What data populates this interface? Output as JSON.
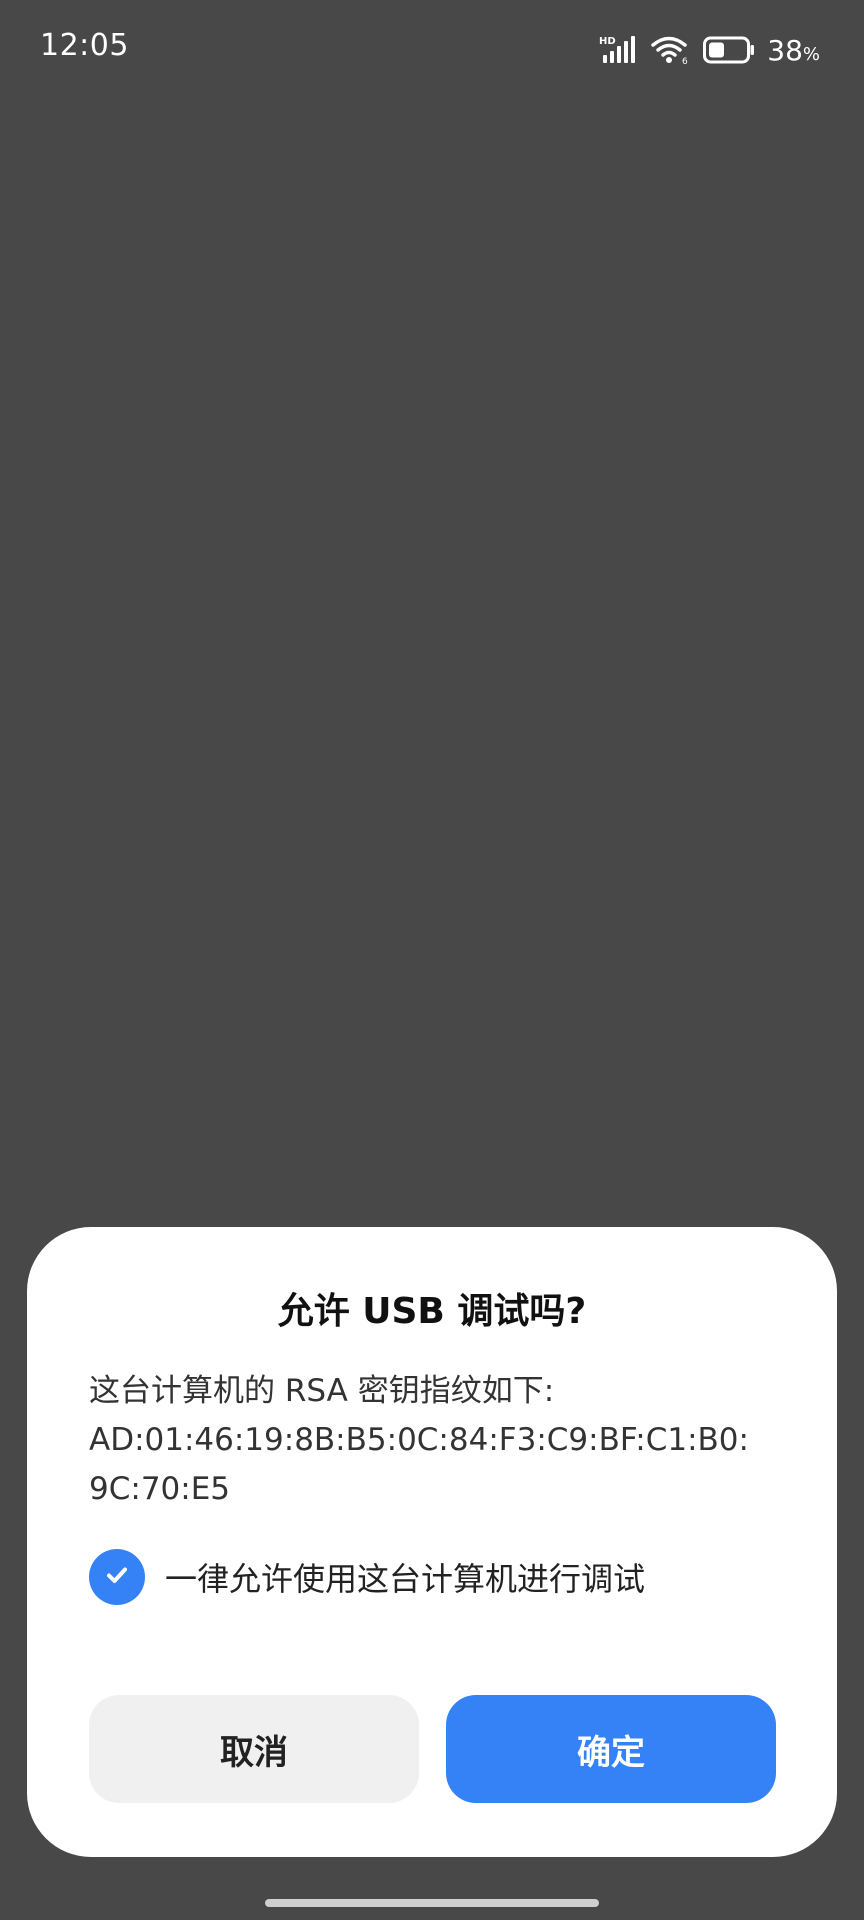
{
  "status_bar": {
    "time": "12:05",
    "network_label": "HD",
    "battery_percent": "38",
    "battery_unit": "%",
    "battery_level": 0.38
  },
  "dialog": {
    "title": "允许 USB 调试吗?",
    "message": "这台计算机的 RSA 密钥指纹如下:\nAD:01:46:19:8B:B5:0C:84:F3:C9:BF:C1:B0:\n9C:70:E5",
    "always_allow_label": "一律允许使用这台计算机进行调试",
    "always_allow_checked": true,
    "cancel_label": "取消",
    "confirm_label": "确定"
  },
  "colors": {
    "overlay": "#484848",
    "accent": "#3482f6",
    "dialog_background": "#ffffff",
    "secondary_button": "#f0f0f0"
  },
  "icons": {
    "signal": "signal-icon",
    "wifi": "wifi-icon",
    "battery": "battery-icon",
    "checkbox": "check-icon"
  }
}
